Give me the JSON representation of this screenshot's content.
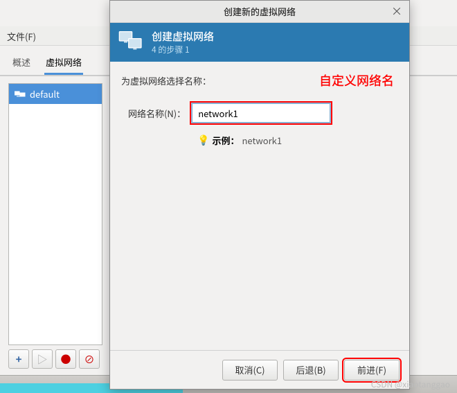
{
  "background": {
    "file_menu": "文件(F)",
    "tabs": {
      "overview": "概述",
      "virtual_net": "虚拟网络"
    },
    "list": {
      "item1": "default"
    },
    "toolbar": {
      "add": "+",
      "play": "▷",
      "stop": "●",
      "delete": "⊘"
    }
  },
  "dialog": {
    "window_title": "创建新的虚拟网络",
    "close": "×",
    "header_title": "创建虚拟网络",
    "header_sub": "4 的步骤 1",
    "prompt": "为虚拟网络选择名称：",
    "field_label": "网络名称(N)：",
    "field_value": "network1",
    "example_label": "示例：",
    "example_value": "network1",
    "annotation": "自定义网络名",
    "buttons": {
      "cancel": "取消(C)",
      "back": "后退(B)",
      "forward": "前进(F)"
    }
  },
  "watermark": "CSDN @xiaotanggao"
}
